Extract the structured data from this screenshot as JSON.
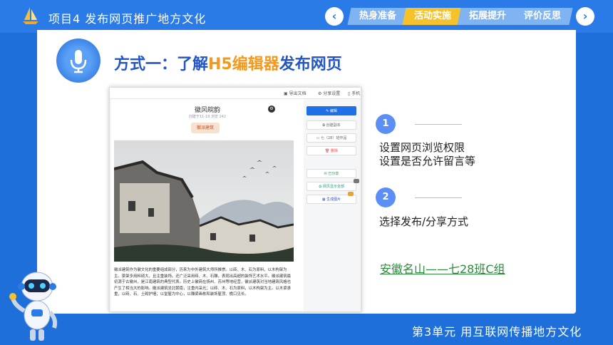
{
  "header": {
    "title": "项目4  发布网页推广地方文化",
    "tabs": [
      {
        "label": "热身准备",
        "active": false
      },
      {
        "label": "活动实施",
        "active": true
      },
      {
        "label": "拓展提升",
        "active": false
      },
      {
        "label": "评价反思",
        "active": false
      }
    ],
    "prev_icon": "chevron-left-icon",
    "next_icon": "chevron-right-icon"
  },
  "main": {
    "headline_part1": "方式一：了解",
    "headline_highlight": "H5编辑器",
    "headline_part2": "发布网页",
    "icon": "microphone-icon",
    "colors": {
      "accent": "#2256c7",
      "highlight": "#f39a1e",
      "brand": "#1e6fd9"
    }
  },
  "screenshot": {
    "toolbar": [
      "导出文档",
      "分享设置",
      "手机"
    ],
    "doc_title": "徽风皖韵",
    "doc_meta": "创建于11-18  浏览 242",
    "tag": "徽派建筑",
    "paragraph": "徽派建筑作为徽文化的重要组成部分，历来为中外建筑大师所推崇。以砖、木、石为原料，以木构架为主。梁架多用料硕大，且注重装饰。还广泛采用砖、木、石雕，表现出高超的装饰艺术水平。徽派建筑最初源于古徽州，是江南建筑的典型代表。历史上徽商在扬州、苏州等地经营，徽派建筑对当地建筑风格也产生了相当大的影响。徽派建筑坐北朝南，注重内采光；以砖、木、石为原料，以木构架为主。以木梁承重，以砖、石、土砌护墙；以堂屋为中心，以雕梁画栋和装饰屋顶、檐口见长。",
    "side_buttons": [
      "编辑",
      "创建副本",
      "七（28）班作品",
      "删除",
      "已分享",
      "网页显示全部",
      "生成图片"
    ]
  },
  "steps": [
    {
      "num": "1",
      "lines": [
        "设置网页浏览权限",
        "设置是否允许留言等"
      ]
    },
    {
      "num": "2",
      "lines": [
        "选择发布/分享方式"
      ]
    }
  ],
  "link_text": "安徽名山——七28班C组",
  "footer": {
    "text": "第3单元   用互联网传播地方文化"
  }
}
